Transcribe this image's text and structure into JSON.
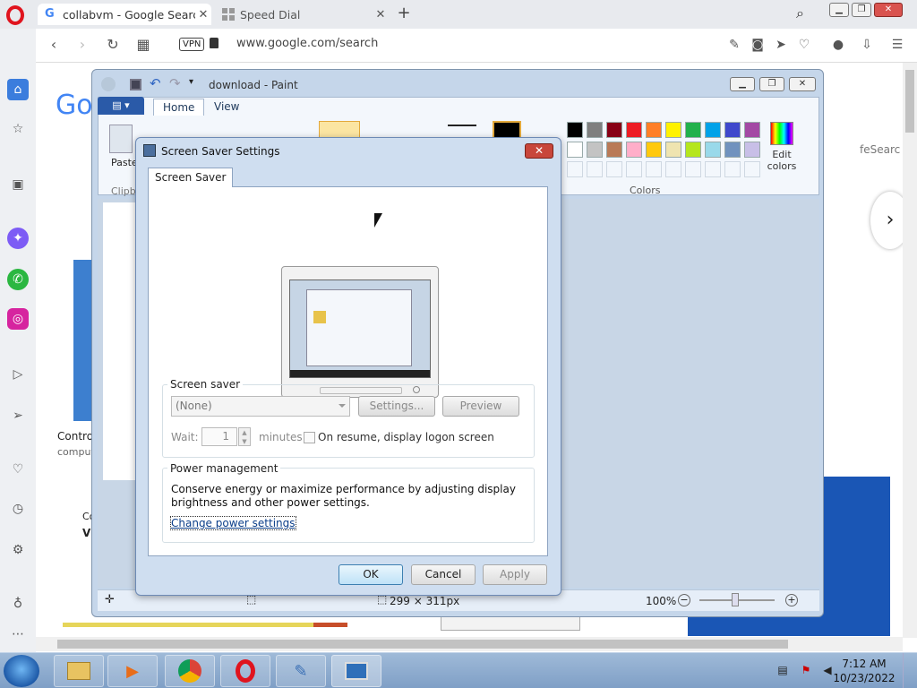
{
  "browser": {
    "tabs": [
      {
        "label": "collabvm - Google Search",
        "active": true
      },
      {
        "label": "Speed Dial",
        "active": false
      }
    ],
    "vpn_label": "VPN",
    "url": "www.google.com/search",
    "page_fragments": {
      "logo_fragment": "Go",
      "control_text": "Contro",
      "computer_text": "comput",
      "safesearch_text": "feSearc",
      "co_text": "Co",
      "vi_text": "Vi"
    }
  },
  "paint": {
    "title": "download - Paint",
    "tabs": {
      "home": "Home",
      "view": "View"
    },
    "paste_label": "Paste",
    "clipboard_label": "Clipb",
    "colors_label": "Colors",
    "edit_colors_label": "Edit colors",
    "palette": [
      "#000000",
      "#7f7f7f",
      "#880015",
      "#ed1c24",
      "#ff7f27",
      "#fff200",
      "#22b14c",
      "#00a2e8",
      "#3f48cc",
      "#a349a4",
      "#ffffff",
      "#c3c3c3",
      "#b97a57",
      "#ffaec9",
      "#ffc90e",
      "#efe4b0",
      "#b5e61d",
      "#99d9ea",
      "#7092be",
      "#c8bfe7"
    ],
    "status": {
      "dimensions": "299 × 311px",
      "zoom": "100%"
    }
  },
  "dialog": {
    "title": "Screen Saver Settings",
    "close_label": "✕",
    "tab": "Screen Saver",
    "screen_saver_group": "Screen saver",
    "selected_saver": "(None)",
    "settings_btn": "Settings...",
    "preview_btn": "Preview",
    "wait_label": "Wait:",
    "wait_value": "1",
    "minutes_label": "minutes",
    "resume_label": "On resume, display logon screen",
    "power_group": "Power management",
    "power_desc": "Conserve energy or maximize performance by adjusting display brightness and other power settings.",
    "power_link": "Change power settings",
    "ok": "OK",
    "cancel": "Cancel",
    "apply": "Apply"
  },
  "taskbar": {
    "time": "7:12 AM",
    "date": "10/23/2022"
  }
}
